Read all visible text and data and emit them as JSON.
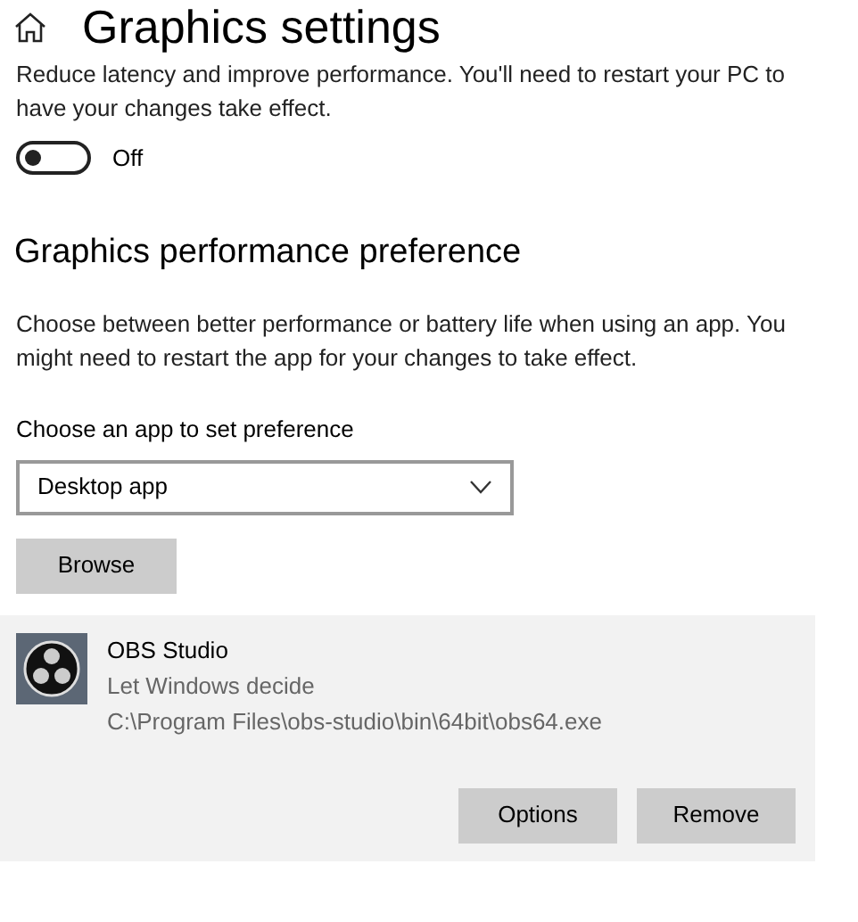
{
  "header": {
    "title": "Graphics settings"
  },
  "description": "Reduce latency and improve performance. You'll need to restart your PC to have your changes take effect.",
  "toggle": {
    "on": false,
    "label": "Off"
  },
  "section": {
    "title": "Graphics performance preference",
    "description": "Choose between better performance or battery life when using an app. You might need to restart the app for your changes to take effect."
  },
  "app_picker": {
    "label": "Choose an app to set preference",
    "value": "Desktop app"
  },
  "browse_button": "Browse",
  "apps": [
    {
      "name": "OBS Studio",
      "preference": "Let Windows decide",
      "path": "C:\\Program Files\\obs-studio\\bin\\64bit\\obs64.exe",
      "selected": true,
      "buttons": [
        "Options",
        "Remove"
      ]
    }
  ]
}
